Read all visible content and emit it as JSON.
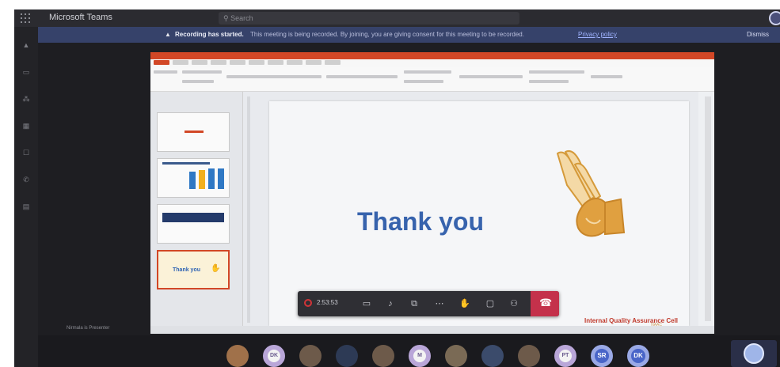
{
  "app": {
    "title": "Microsoft Teams",
    "search_placeholder": "Search"
  },
  "banner": {
    "bold_text": "Recording has started.",
    "message": "This meeting is being recorded. By joining, you are giving consent for this meeting to be recorded.",
    "policy_link": "Privacy policy",
    "dismiss_label": "Dismiss"
  },
  "slide": {
    "main_text": "Thank you",
    "footer_org": "Internal Quality Assurance Cell",
    "footer_sub": "NAAC"
  },
  "thumbnails": {
    "last_text": "Thank you"
  },
  "controls": {
    "timer": "2:53:53"
  },
  "presenter_label": "Nirmala is Presenter",
  "participants": [
    {
      "kind": "photo",
      "initials": ""
    },
    {
      "kind": "initials",
      "initials": "DK"
    },
    {
      "kind": "photo",
      "initials": ""
    },
    {
      "kind": "photo",
      "initials": ""
    },
    {
      "kind": "photo",
      "initials": ""
    },
    {
      "kind": "initials",
      "initials": "M"
    },
    {
      "kind": "photo",
      "initials": ""
    },
    {
      "kind": "photo",
      "initials": ""
    },
    {
      "kind": "photo",
      "initials": ""
    },
    {
      "kind": "initials",
      "initials": "PT"
    },
    {
      "kind": "initials",
      "initials": "SR"
    },
    {
      "kind": "initials",
      "initials": "DK"
    }
  ],
  "colors": {
    "accent": "#d24726",
    "banner": "#36426a",
    "slide_text": "#3763ad",
    "hangup": "#c4314b"
  }
}
